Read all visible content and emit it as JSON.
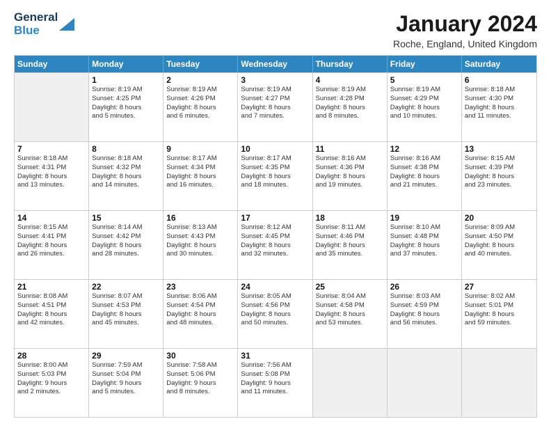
{
  "header": {
    "logo_line1": "General",
    "logo_line2": "Blue",
    "title": "January 2024",
    "subtitle": "Roche, England, United Kingdom"
  },
  "weekdays": [
    "Sunday",
    "Monday",
    "Tuesday",
    "Wednesday",
    "Thursday",
    "Friday",
    "Saturday"
  ],
  "weeks": [
    [
      {
        "day": "",
        "sunrise": "",
        "sunset": "",
        "daylight": "",
        "empty": true
      },
      {
        "day": "1",
        "sunrise": "Sunrise: 8:19 AM",
        "sunset": "Sunset: 4:25 PM",
        "daylight": "Daylight: 8 hours",
        "daylight2": "and 5 minutes."
      },
      {
        "day": "2",
        "sunrise": "Sunrise: 8:19 AM",
        "sunset": "Sunset: 4:26 PM",
        "daylight": "Daylight: 8 hours",
        "daylight2": "and 6 minutes."
      },
      {
        "day": "3",
        "sunrise": "Sunrise: 8:19 AM",
        "sunset": "Sunset: 4:27 PM",
        "daylight": "Daylight: 8 hours",
        "daylight2": "and 7 minutes."
      },
      {
        "day": "4",
        "sunrise": "Sunrise: 8:19 AM",
        "sunset": "Sunset: 4:28 PM",
        "daylight": "Daylight: 8 hours",
        "daylight2": "and 8 minutes."
      },
      {
        "day": "5",
        "sunrise": "Sunrise: 8:19 AM",
        "sunset": "Sunset: 4:29 PM",
        "daylight": "Daylight: 8 hours",
        "daylight2": "and 10 minutes."
      },
      {
        "day": "6",
        "sunrise": "Sunrise: 8:18 AM",
        "sunset": "Sunset: 4:30 PM",
        "daylight": "Daylight: 8 hours",
        "daylight2": "and 11 minutes."
      }
    ],
    [
      {
        "day": "7",
        "sunrise": "Sunrise: 8:18 AM",
        "sunset": "Sunset: 4:31 PM",
        "daylight": "Daylight: 8 hours",
        "daylight2": "and 13 minutes."
      },
      {
        "day": "8",
        "sunrise": "Sunrise: 8:18 AM",
        "sunset": "Sunset: 4:32 PM",
        "daylight": "Daylight: 8 hours",
        "daylight2": "and 14 minutes."
      },
      {
        "day": "9",
        "sunrise": "Sunrise: 8:17 AM",
        "sunset": "Sunset: 4:34 PM",
        "daylight": "Daylight: 8 hours",
        "daylight2": "and 16 minutes."
      },
      {
        "day": "10",
        "sunrise": "Sunrise: 8:17 AM",
        "sunset": "Sunset: 4:35 PM",
        "daylight": "Daylight: 8 hours",
        "daylight2": "and 18 minutes."
      },
      {
        "day": "11",
        "sunrise": "Sunrise: 8:16 AM",
        "sunset": "Sunset: 4:36 PM",
        "daylight": "Daylight: 8 hours",
        "daylight2": "and 19 minutes."
      },
      {
        "day": "12",
        "sunrise": "Sunrise: 8:16 AM",
        "sunset": "Sunset: 4:38 PM",
        "daylight": "Daylight: 8 hours",
        "daylight2": "and 21 minutes."
      },
      {
        "day": "13",
        "sunrise": "Sunrise: 8:15 AM",
        "sunset": "Sunset: 4:39 PM",
        "daylight": "Daylight: 8 hours",
        "daylight2": "and 23 minutes."
      }
    ],
    [
      {
        "day": "14",
        "sunrise": "Sunrise: 8:15 AM",
        "sunset": "Sunset: 4:41 PM",
        "daylight": "Daylight: 8 hours",
        "daylight2": "and 26 minutes."
      },
      {
        "day": "15",
        "sunrise": "Sunrise: 8:14 AM",
        "sunset": "Sunset: 4:42 PM",
        "daylight": "Daylight: 8 hours",
        "daylight2": "and 28 minutes."
      },
      {
        "day": "16",
        "sunrise": "Sunrise: 8:13 AM",
        "sunset": "Sunset: 4:43 PM",
        "daylight": "Daylight: 8 hours",
        "daylight2": "and 30 minutes."
      },
      {
        "day": "17",
        "sunrise": "Sunrise: 8:12 AM",
        "sunset": "Sunset: 4:45 PM",
        "daylight": "Daylight: 8 hours",
        "daylight2": "and 32 minutes."
      },
      {
        "day": "18",
        "sunrise": "Sunrise: 8:11 AM",
        "sunset": "Sunset: 4:46 PM",
        "daylight": "Daylight: 8 hours",
        "daylight2": "and 35 minutes."
      },
      {
        "day": "19",
        "sunrise": "Sunrise: 8:10 AM",
        "sunset": "Sunset: 4:48 PM",
        "daylight": "Daylight: 8 hours",
        "daylight2": "and 37 minutes."
      },
      {
        "day": "20",
        "sunrise": "Sunrise: 8:09 AM",
        "sunset": "Sunset: 4:50 PM",
        "daylight": "Daylight: 8 hours",
        "daylight2": "and 40 minutes."
      }
    ],
    [
      {
        "day": "21",
        "sunrise": "Sunrise: 8:08 AM",
        "sunset": "Sunset: 4:51 PM",
        "daylight": "Daylight: 8 hours",
        "daylight2": "and 42 minutes."
      },
      {
        "day": "22",
        "sunrise": "Sunrise: 8:07 AM",
        "sunset": "Sunset: 4:53 PM",
        "daylight": "Daylight: 8 hours",
        "daylight2": "and 45 minutes."
      },
      {
        "day": "23",
        "sunrise": "Sunrise: 8:06 AM",
        "sunset": "Sunset: 4:54 PM",
        "daylight": "Daylight: 8 hours",
        "daylight2": "and 48 minutes."
      },
      {
        "day": "24",
        "sunrise": "Sunrise: 8:05 AM",
        "sunset": "Sunset: 4:56 PM",
        "daylight": "Daylight: 8 hours",
        "daylight2": "and 50 minutes."
      },
      {
        "day": "25",
        "sunrise": "Sunrise: 8:04 AM",
        "sunset": "Sunset: 4:58 PM",
        "daylight": "Daylight: 8 hours",
        "daylight2": "and 53 minutes."
      },
      {
        "day": "26",
        "sunrise": "Sunrise: 8:03 AM",
        "sunset": "Sunset: 4:59 PM",
        "daylight": "Daylight: 8 hours",
        "daylight2": "and 56 minutes."
      },
      {
        "day": "27",
        "sunrise": "Sunrise: 8:02 AM",
        "sunset": "Sunset: 5:01 PM",
        "daylight": "Daylight: 8 hours",
        "daylight2": "and 59 minutes."
      }
    ],
    [
      {
        "day": "28",
        "sunrise": "Sunrise: 8:00 AM",
        "sunset": "Sunset: 5:03 PM",
        "daylight": "Daylight: 9 hours",
        "daylight2": "and 2 minutes."
      },
      {
        "day": "29",
        "sunrise": "Sunrise: 7:59 AM",
        "sunset": "Sunset: 5:04 PM",
        "daylight": "Daylight: 9 hours",
        "daylight2": "and 5 minutes."
      },
      {
        "day": "30",
        "sunrise": "Sunrise: 7:58 AM",
        "sunset": "Sunset: 5:06 PM",
        "daylight": "Daylight: 9 hours",
        "daylight2": "and 8 minutes."
      },
      {
        "day": "31",
        "sunrise": "Sunrise: 7:56 AM",
        "sunset": "Sunset: 5:08 PM",
        "daylight": "Daylight: 9 hours",
        "daylight2": "and 11 minutes."
      },
      {
        "day": "",
        "sunrise": "",
        "sunset": "",
        "daylight": "",
        "daylight2": "",
        "empty": true
      },
      {
        "day": "",
        "sunrise": "",
        "sunset": "",
        "daylight": "",
        "daylight2": "",
        "empty": true
      },
      {
        "day": "",
        "sunrise": "",
        "sunset": "",
        "daylight": "",
        "daylight2": "",
        "empty": true
      }
    ]
  ]
}
